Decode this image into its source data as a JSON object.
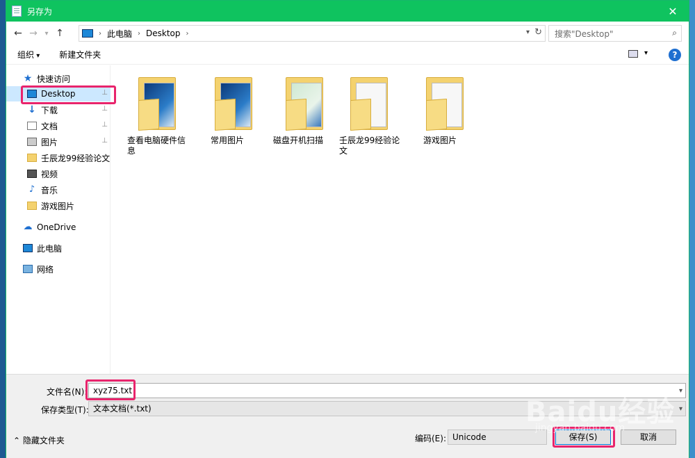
{
  "window": {
    "title": "另存为",
    "close_label": "✕"
  },
  "nav": {
    "back": "←",
    "forward": "→",
    "recent": "▾",
    "up": "↑",
    "breadcrumb": [
      "此电脑",
      "Desktop"
    ],
    "refresh": "↻",
    "search_placeholder": "搜索\"Desktop\""
  },
  "toolbar": {
    "organize": "组织",
    "new_folder": "新建文件夹",
    "help": "?"
  },
  "sidebar": {
    "items": [
      {
        "label": "快速访问",
        "icon": "star-icon"
      },
      {
        "label": "Desktop",
        "icon": "desktop-icon",
        "pinned": true,
        "selected": true
      },
      {
        "label": "下载",
        "icon": "download-icon",
        "pinned": true
      },
      {
        "label": "文档",
        "icon": "document-icon",
        "pinned": true
      },
      {
        "label": "图片",
        "icon": "pictures-icon",
        "pinned": true
      },
      {
        "label": "壬辰龙99经验论文",
        "icon": "folder-icon"
      },
      {
        "label": "视频",
        "icon": "video-icon"
      },
      {
        "label": "音乐",
        "icon": "music-icon"
      },
      {
        "label": "游戏图片",
        "icon": "folder-icon"
      },
      {
        "label": "OneDrive",
        "icon": "onedrive-icon"
      },
      {
        "label": "此电脑",
        "icon": "computer-icon"
      },
      {
        "label": "网络",
        "icon": "network-icon"
      }
    ],
    "pin_glyph": "📌"
  },
  "files": [
    {
      "name": "查看电脑硬件信息",
      "name_line2": "息",
      "name_line1": "查看电脑硬件信",
      "thumb": "blue"
    },
    {
      "name": "常用图片",
      "thumb": "blue"
    },
    {
      "name": "磁盘开机扫描",
      "thumb": "green"
    },
    {
      "name_line1": "壬辰龙99经验论",
      "name_line2": "文",
      "thumb": "white"
    },
    {
      "name": "游戏图片",
      "thumb": "white"
    }
  ],
  "form": {
    "filename_label": "文件名(N):",
    "filename_value": "xyz75.txt",
    "filetype_label": "保存类型(T):",
    "filetype_value": "文本文档(*.txt)",
    "hide_folders": "隐藏文件夹",
    "encoding_label": "编码(E):",
    "encoding_value": "Unicode",
    "save": "保存(S)",
    "cancel": "取消"
  },
  "watermark": {
    "brand": "Baidu经验",
    "url": "jingyan.baidu.com"
  },
  "colors": {
    "titlebar": "#0fc35f",
    "highlight": "#e8246c",
    "accent": "#1e6fd0"
  }
}
